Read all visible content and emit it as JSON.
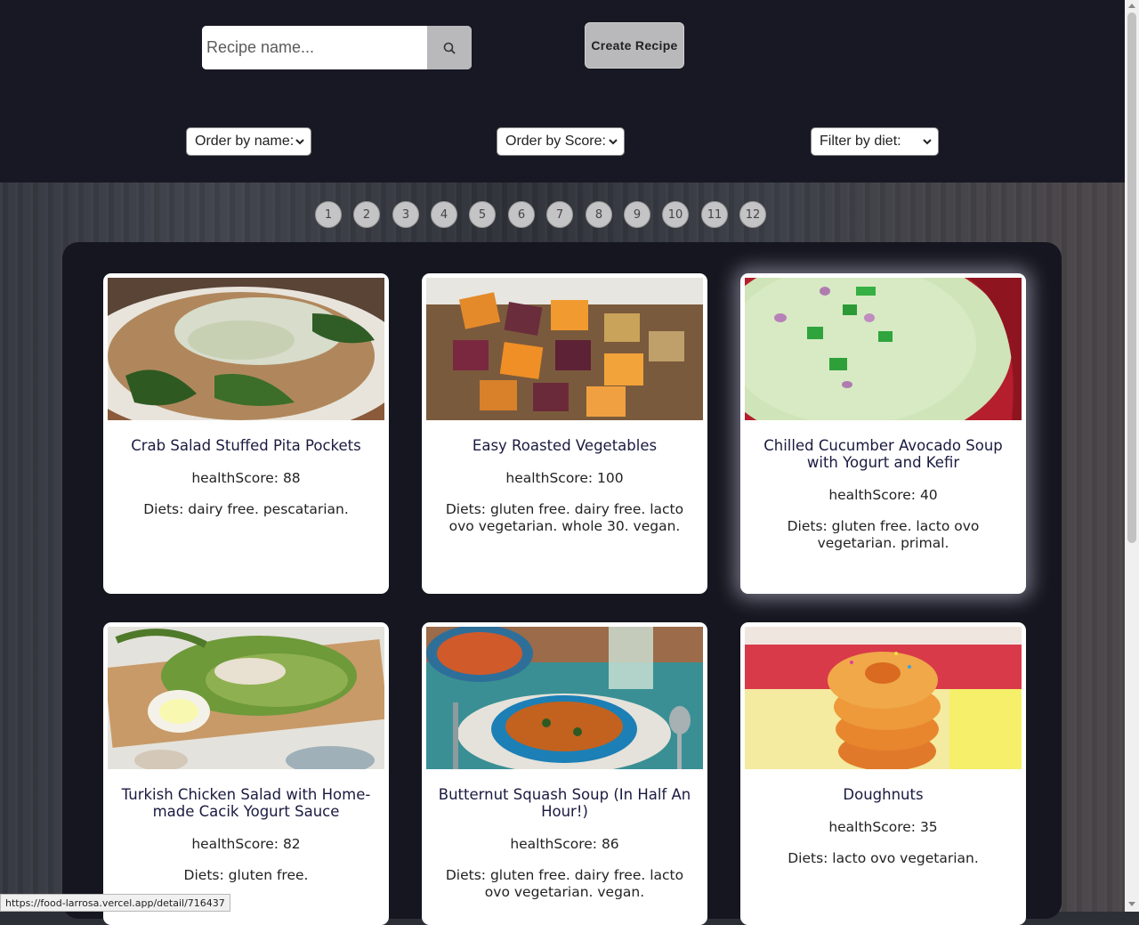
{
  "search": {
    "placeholder": "Recipe name..."
  },
  "header": {
    "create_label": "Create Recipe"
  },
  "filters": {
    "order_name": "Order by name:",
    "order_score": "Order by Score:",
    "diet": "Filter by diet:"
  },
  "pagination": [
    "1",
    "2",
    "3",
    "4",
    "5",
    "6",
    "7",
    "8",
    "9",
    "10",
    "11",
    "12"
  ],
  "cards": [
    {
      "title": "Crab Salad Stuffed Pita Pockets",
      "score": "healthScore: 88",
      "diets": "Diets: dairy free. pescatarian."
    },
    {
      "title": "Easy Roasted Vegetables",
      "score": "healthScore: 100",
      "diets": "Diets: gluten free. dairy free. lacto ovo vegetarian. whole 30. vegan."
    },
    {
      "title": "Chilled Cucumber Avocado Soup with Yogurt and Kefir",
      "score": "healthScore: 40",
      "diets": "Diets: gluten free. lacto ovo vegetarian. primal."
    },
    {
      "title": "Turkish Chicken Salad with Home-made Cacik Yogurt Sauce",
      "score": "healthScore: 82",
      "diets": "Diets: gluten free."
    },
    {
      "title": "Butternut Squash Soup (In Half An Hour!)",
      "score": "healthScore: 86",
      "diets": "Diets: gluten free. dairy free. lacto ovo vegetarian. vegan."
    },
    {
      "title": "Doughnuts",
      "score": "healthScore: 35",
      "diets": "Diets: lacto ovo vegetarian."
    }
  ],
  "status_url": "https://food-larrosa.vercel.app/detail/716437",
  "icons": {
    "search": "search-icon",
    "caret": "chevron-down-icon"
  }
}
